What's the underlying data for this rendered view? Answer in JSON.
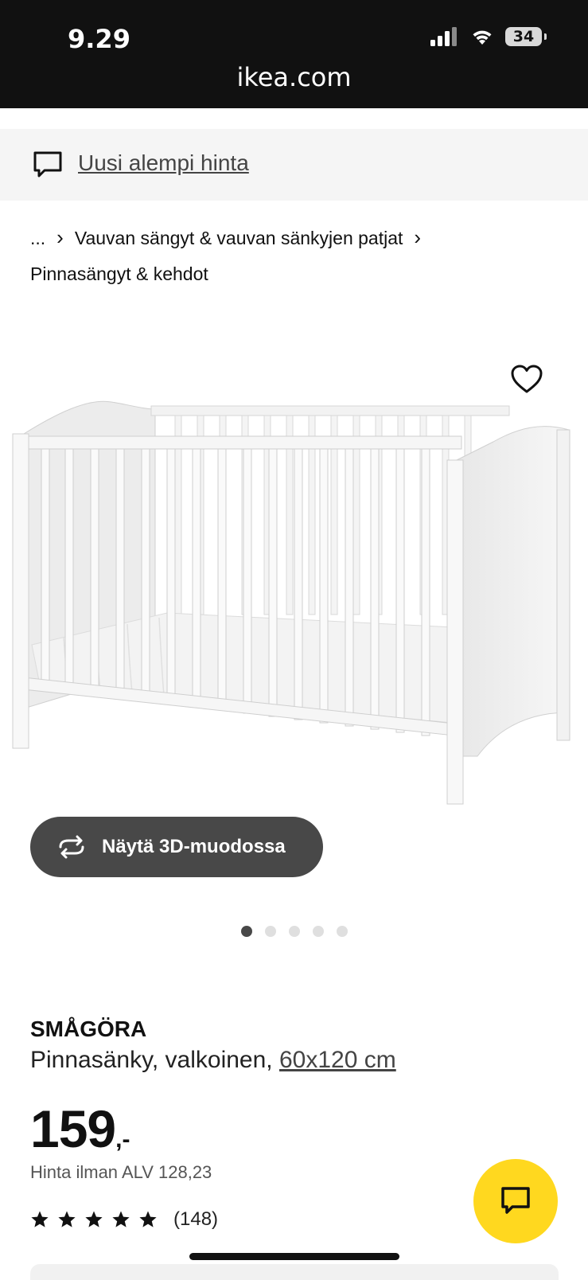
{
  "status_bar": {
    "time": "9.29",
    "battery": "34"
  },
  "browser": {
    "url": "ikea.com"
  },
  "banner": {
    "text": "Uusi alempi hinta",
    "icon": "chat-bubble-icon"
  },
  "breadcrumb": {
    "items": [
      "...",
      "Vauvan sängyt & vauvan sänkyjen patjat",
      "Pinnasängyt & kehdot"
    ],
    "separator": "›"
  },
  "gallery": {
    "favorite_icon": "heart-icon",
    "view_3d_label": "Näytä 3D-muodossa",
    "view_3d_icon": "rotate-icon",
    "image_count": 5,
    "active_index": 0
  },
  "product": {
    "name": "SMÅGÖRA",
    "description": "Pinnasänky, valkoinen,",
    "size": "60x120 cm",
    "price_integer": "159",
    "price_suffix": ",-",
    "vat_text": "Hinta ilman ALV 128,23",
    "rating": 5,
    "review_count": "(148)"
  },
  "chat": {
    "icon": "chat-icon"
  },
  "colors": {
    "topbar": "#111111",
    "banner_bg": "#f5f5f5",
    "button_dark": "#484848",
    "chat_yellow": "#ffd81f"
  }
}
